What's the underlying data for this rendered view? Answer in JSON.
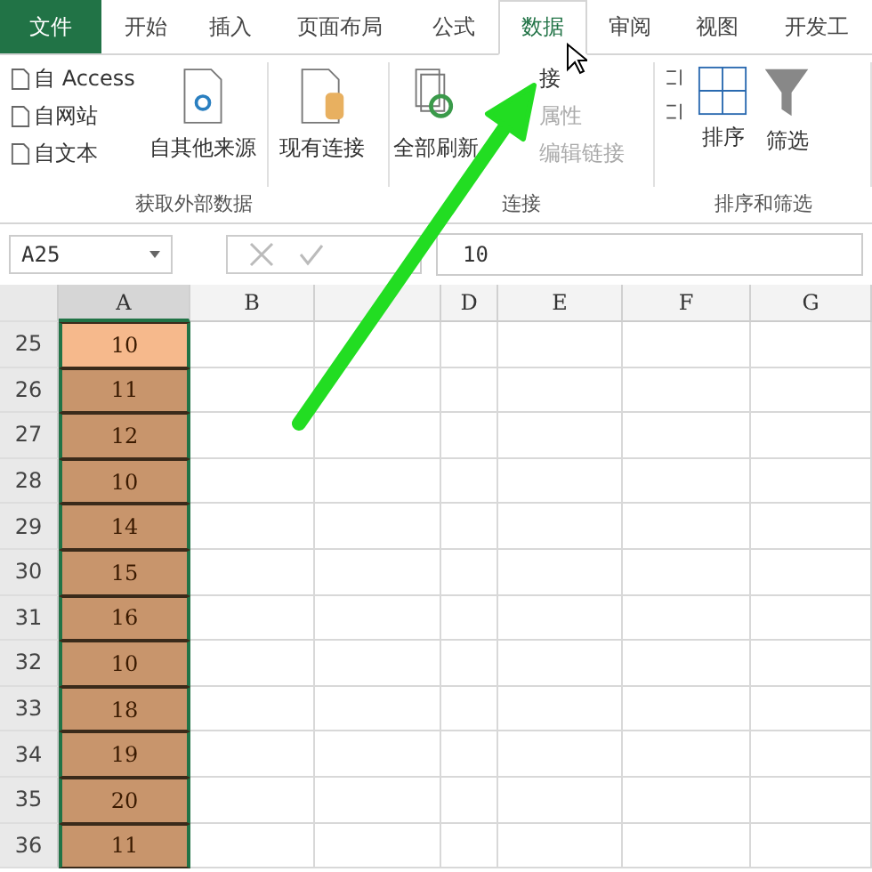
{
  "tabs": [
    {
      "label": "文件",
      "kind": "file",
      "selected": false
    },
    {
      "label": "开始",
      "kind": "tab",
      "selected": false
    },
    {
      "label": "插入",
      "kind": "tab",
      "selected": false
    },
    {
      "label": "页面布局",
      "kind": "tab",
      "selected": false
    },
    {
      "label": "公式",
      "kind": "tab",
      "selected": false
    },
    {
      "label": "数据",
      "kind": "tab",
      "selected": true
    },
    {
      "label": "审阅",
      "kind": "tab",
      "selected": false
    },
    {
      "label": "视图",
      "kind": "tab",
      "selected": false
    },
    {
      "label": "开发工",
      "kind": "tab",
      "selected": false
    }
  ],
  "ribbon": {
    "external_data": {
      "small": [
        "自 Access",
        "自网站",
        "自文本"
      ],
      "other_sources": "自其他来源",
      "existing": "现有连接",
      "label": "获取外部数据"
    },
    "connections": {
      "refresh_all": "全部刷新",
      "connect": "接",
      "properties": "属性",
      "edit_links": "编辑链接",
      "label": "连接"
    },
    "sort_filter": {
      "sort": "排序",
      "filter": "筛选",
      "label": "排序和筛选"
    }
  },
  "name_box": "A25",
  "formula": "10",
  "columns": [
    {
      "label": "A",
      "selected": true
    },
    {
      "label": "B",
      "selected": false
    },
    {
      "selected": false
    },
    {
      "label": "D",
      "selected": false
    },
    {
      "label": "E",
      "selected": false
    },
    {
      "label": "F",
      "selected": false
    },
    {
      "label": "G",
      "selected": false
    }
  ],
  "rows": [
    {
      "number": "25",
      "value": "10",
      "selected": true
    },
    {
      "number": "26",
      "value": "11",
      "selected": false
    },
    {
      "number": "27",
      "value": "12",
      "selected": false
    },
    {
      "number": "28",
      "value": "10",
      "selected": false
    },
    {
      "number": "29",
      "value": "14",
      "selected": false
    },
    {
      "number": "30",
      "value": "15",
      "selected": false
    },
    {
      "number": "31",
      "value": "16",
      "selected": false
    },
    {
      "number": "32",
      "value": "10",
      "selected": false
    },
    {
      "number": "33",
      "value": "18",
      "selected": false
    },
    {
      "number": "34",
      "value": "19",
      "selected": false
    },
    {
      "number": "35",
      "value": "20",
      "selected": false
    },
    {
      "number": "36",
      "value": "11",
      "selected": false
    }
  ]
}
